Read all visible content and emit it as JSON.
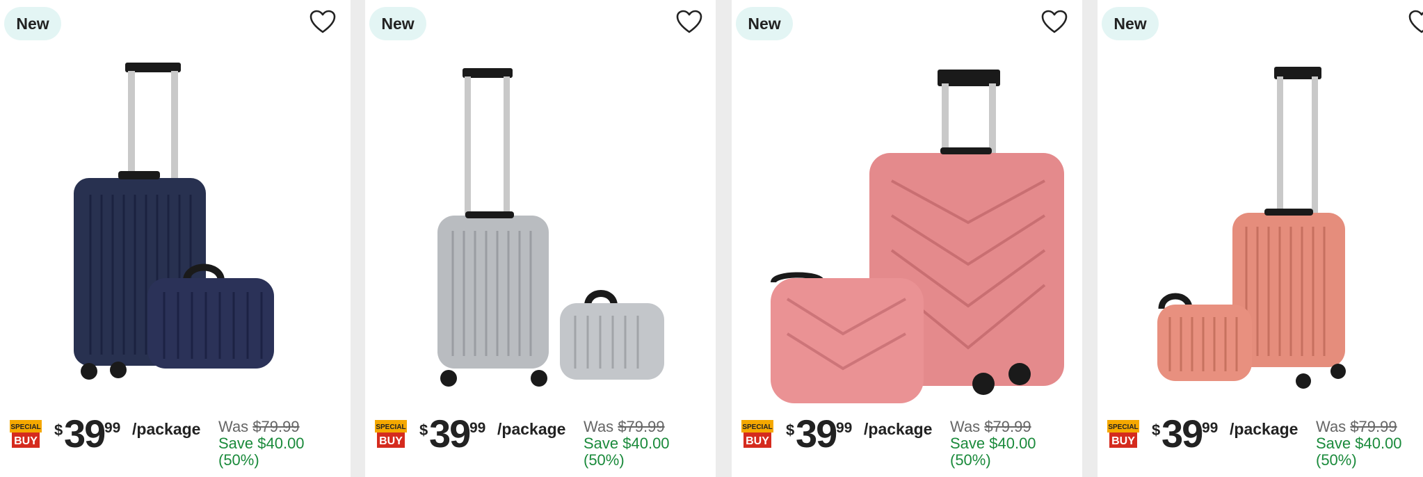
{
  "cards": [
    {
      "badge": "New",
      "special_top": "SPECIAL",
      "special_bottom": "BUY",
      "currency": "$",
      "dollars": "39",
      "cents": "99",
      "unit": "/package",
      "was_label": "Was",
      "was_price": "$79.99",
      "save_line1": "Save $40.00",
      "save_line2": "(50%)",
      "color": "#283150"
    },
    {
      "badge": "New",
      "special_top": "SPECIAL",
      "special_bottom": "BUY",
      "currency": "$",
      "dollars": "39",
      "cents": "99",
      "unit": "/package",
      "was_label": "Was",
      "was_price": "$79.99",
      "save_line1": "Save $40.00",
      "save_line2": "(50%)",
      "color": "#b9bcc0"
    },
    {
      "badge": "New",
      "special_top": "SPECIAL",
      "special_bottom": "BUY",
      "currency": "$",
      "dollars": "39",
      "cents": "99",
      "unit": "/package",
      "was_label": "Was",
      "was_price": "$79.99",
      "save_line1": "Save $40.00",
      "save_line2": "(50%)",
      "color": "#e48a8c"
    },
    {
      "badge": "New",
      "special_top": "SPECIAL",
      "special_bottom": "BUY",
      "currency": "$",
      "dollars": "39",
      "cents": "99",
      "unit": "/package",
      "was_label": "Was",
      "was_price": "$79.99",
      "save_line1": "Save $40.00",
      "save_line2": "(50%)",
      "color": "#e58d7c"
    }
  ],
  "colors": {
    "badge_bg": "#e3f5f4",
    "save_green": "#1a8a3b",
    "special_orange": "#f5a800",
    "special_red": "#d52b1e"
  },
  "icons": [
    "heart-outline-icon",
    "special-buy-logo"
  ]
}
